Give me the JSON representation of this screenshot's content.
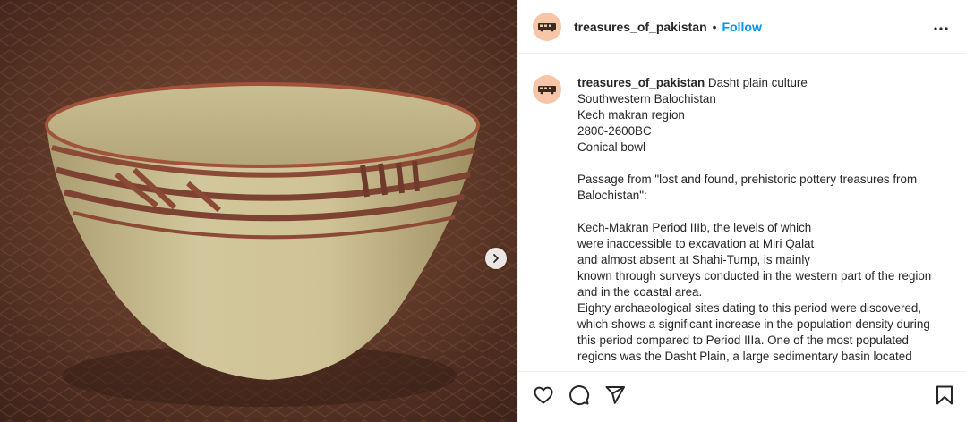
{
  "post": {
    "username": "treasures_of_pakistan",
    "separator": "•",
    "follow_label": "Follow",
    "caption": {
      "username": "treasures_of_pakistan",
      "first_line": "Dasht plain culture",
      "lines": [
        "Southwestern Balochistan",
        "Kech makran region",
        "2800-2600BC",
        "Conical bowl",
        "",
        "Passage from \"lost and found, prehistoric pottery treasures from",
        "Balochistan\":",
        "",
        "Kech-Makran Period IIIb, the levels of which",
        "were inaccessible to excavation at Miri Qalat",
        "and almost absent at Shahi-Tump, is mainly",
        "known through surveys conducted in the western part of the region",
        "and in the coastal area.",
        "Eighty archaeological sites dating to this period were discovered,",
        "which shows a significant increase in the population density during",
        "this period compared to Period IIIa. One of the most populated",
        "regions was the Dasht Plain, a large sedimentary basin located"
      ]
    }
  },
  "icons": {
    "avatar": "bus-logo-icon",
    "more": "more-options-icon",
    "next": "chevron-right-icon",
    "like": "heart-icon",
    "comment": "comment-icon",
    "share": "share-icon",
    "save": "bookmark-icon"
  },
  "colors": {
    "accent": "#0095f6",
    "text": "#262626",
    "divider": "#efefef",
    "avatar_bg": "#f6c6a6"
  }
}
